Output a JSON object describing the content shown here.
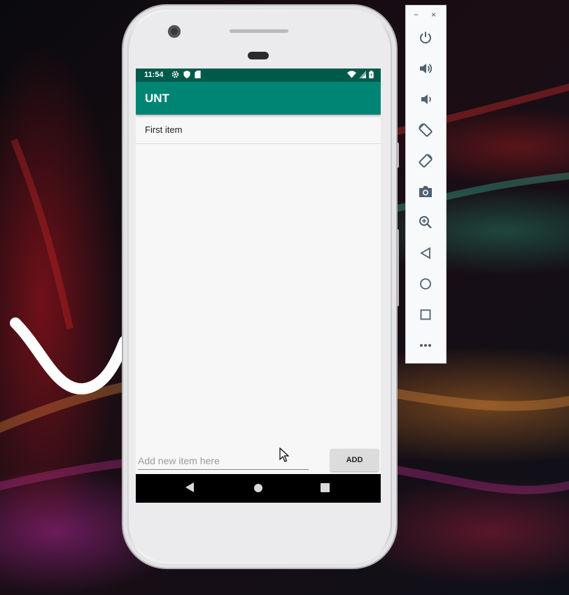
{
  "status_bar": {
    "time": "11:54",
    "left_icons": [
      "gear-icon",
      "shield-icon",
      "sd-card-icon"
    ],
    "right_icons": [
      "wifi-icon",
      "signal-icon",
      "battery-icon"
    ]
  },
  "app_bar": {
    "title": "UNT"
  },
  "list": {
    "items": [
      {
        "label": "First item"
      }
    ]
  },
  "input": {
    "placeholder": "Add new item here",
    "value": ""
  },
  "add_button": {
    "label": "ADD"
  },
  "nav_bar": {
    "buttons": [
      "back-icon",
      "home-icon",
      "recents-icon"
    ]
  },
  "emulator_toolbar": {
    "window_controls": {
      "minimize": "−",
      "close": "×"
    },
    "buttons": [
      "power-icon",
      "volume-up-icon",
      "volume-down-icon",
      "rotate-left-icon",
      "rotate-right-icon",
      "camera-icon",
      "zoom-icon",
      "back-icon",
      "home-icon",
      "overview-icon",
      "more-icon"
    ]
  },
  "colors": {
    "status_bar": "#005a4b",
    "app_bar": "#008574",
    "screen_background": "#f7f7f7",
    "nav_bar": "#000000",
    "button_background": "#dcdcdc"
  }
}
